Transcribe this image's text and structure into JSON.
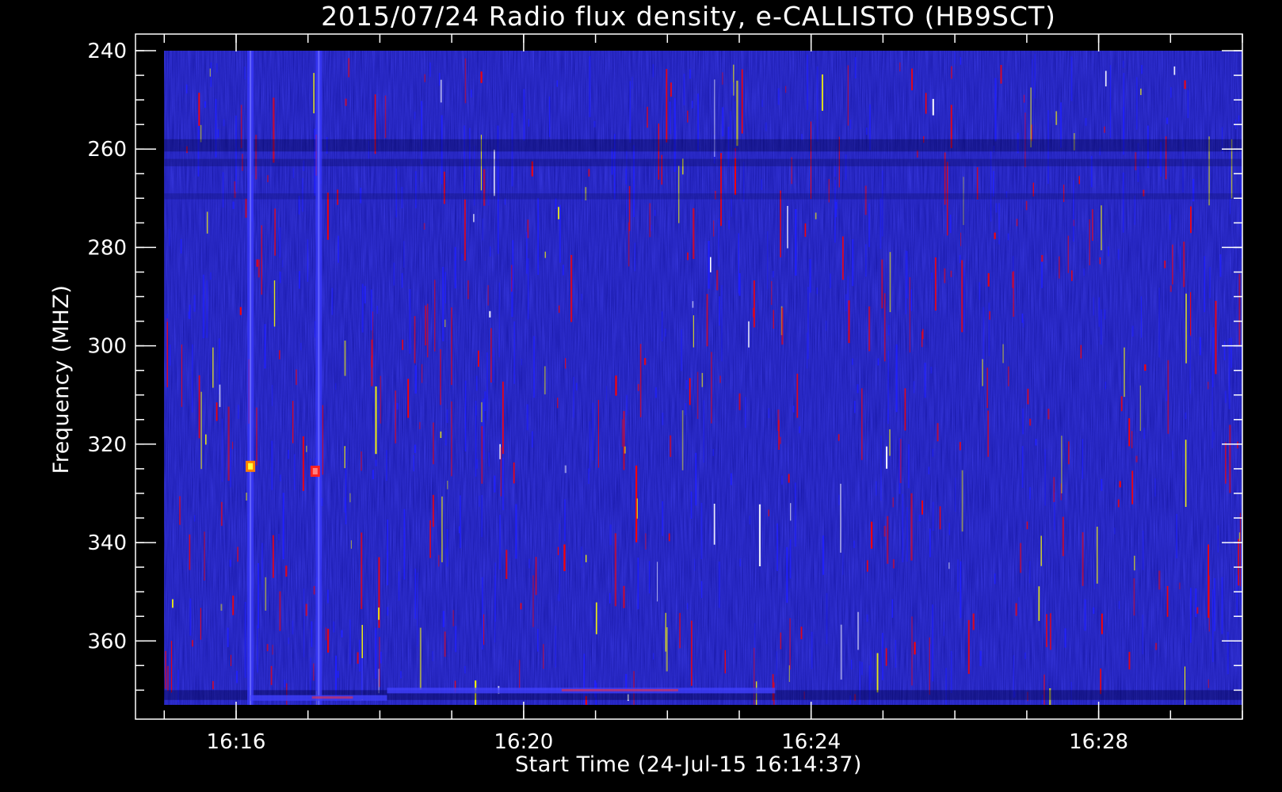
{
  "chart_data": {
    "type": "heatmap",
    "title": "2015/07/24  Radio flux density, e-CALLISTO (HB9SCT)",
    "xlabel": "Start Time (24-Jul-15 16:14:37)",
    "ylabel": "Frequency (MHZ)",
    "x_axis": {
      "unit": "minutes",
      "range": [
        "16:14:37",
        "16:29:37"
      ],
      "tick_labels": [
        "16:16",
        "16:20",
        "16:24",
        "16:28"
      ],
      "tick_values_min": [
        16,
        20,
        24,
        28
      ],
      "minor_tick_step_min": 1,
      "minor_tick_start_min": 15
    },
    "y_axis": {
      "unit": "MHz",
      "range": [
        240,
        373
      ],
      "inverted": true,
      "tick_labels": [
        "240",
        "260",
        "280",
        "300",
        "320",
        "340",
        "360"
      ],
      "tick_values": [
        240,
        260,
        280,
        300,
        320,
        340,
        360
      ],
      "minor_tick_step": 5
    },
    "plot_range_time_min": [
      14.6,
      30.0
    ],
    "data_start_min": 15.0,
    "data_end_min": 30.0,
    "colormap": [
      "#000000",
      "#0000a0",
      "#2020ff",
      "#ff0000",
      "#ffff00",
      "#ffffff"
    ],
    "background_color": "#1414a0",
    "features": [
      {
        "label": "broadband vertical line",
        "time_min": 16.2,
        "intensity": "bright"
      },
      {
        "label": "broadband vertical line",
        "time_min": 17.15,
        "intensity": "bright"
      },
      {
        "label": "hot spot",
        "time_min": 16.2,
        "freq_mhz": 324.5,
        "intensity": "peak"
      },
      {
        "label": "hot spot",
        "time_min": 17.1,
        "freq_mhz": 325.5,
        "intensity": "high"
      },
      {
        "label": "horizontal band",
        "time_start_min": 18.1,
        "time_end_min": 23.5,
        "freq_mhz": 370,
        "intensity": "medium"
      },
      {
        "label": "horizontal band",
        "time_start_min": 16.2,
        "time_end_min": 18.1,
        "freq_mhz": 371.5,
        "intensity": "medium"
      }
    ]
  }
}
